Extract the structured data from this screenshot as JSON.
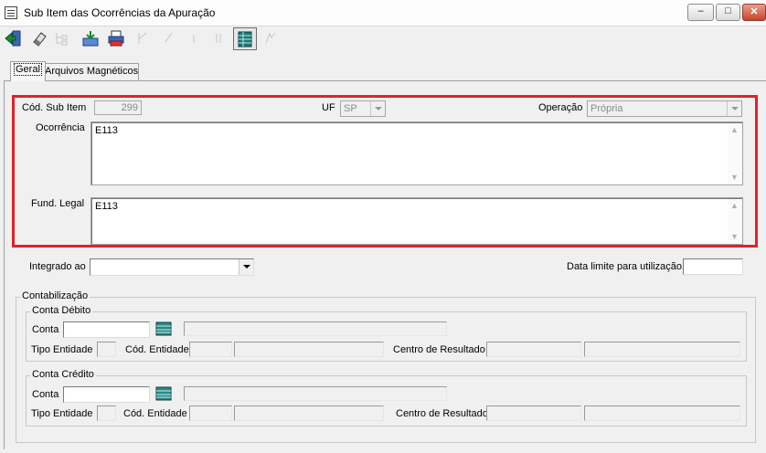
{
  "window": {
    "title": "Sub Item das Ocorrências da Apuração",
    "minimize_glyph": "–",
    "maximize_glyph": "□",
    "close_glyph": "✕"
  },
  "toolbar": {
    "buttons": [
      {
        "name": "exit-icon",
        "enabled": true
      },
      {
        "name": "eraser-icon",
        "enabled": true
      },
      {
        "name": "tree-icon",
        "enabled": false
      },
      {
        "name": "save-icon",
        "enabled": true
      },
      {
        "name": "print-icon",
        "enabled": true
      },
      {
        "name": "first-icon",
        "enabled": false
      },
      {
        "name": "prev-icon",
        "enabled": false
      },
      {
        "name": "next-icon",
        "enabled": false
      },
      {
        "name": "last-icon",
        "enabled": false
      },
      {
        "name": "grid-icon",
        "enabled": true
      },
      {
        "name": "refresh-icon",
        "enabled": false
      }
    ]
  },
  "tabs": [
    "Geral",
    "Arquivos Magnéticos"
  ],
  "form": {
    "cod_sub_item_label": "Cód. Sub Item",
    "cod_sub_item_value": "299",
    "uf_label": "UF",
    "uf_value": "SP",
    "operacao_label": "Operação",
    "operacao_value": "Própria",
    "ocorrencia_label": "Ocorrência",
    "ocorrencia_value": "E113",
    "fund_legal_label": "Fund. Legal",
    "fund_legal_value": "E113",
    "integrado_label": "Integrado ao",
    "integrado_value": "",
    "data_limite_label": "Data limite para utilização:",
    "data_limite_value": ""
  },
  "contabilizacao": {
    "legend": "Contabilização",
    "debito": {
      "legend": "Conta Débito",
      "conta_label": "Conta",
      "tipo_entidade_label": "Tipo Entidade",
      "cod_entidade_label": "Cód. Entidade",
      "centro_resultado_label": "Centro de Resultado"
    },
    "credito": {
      "legend": "Conta Crédito",
      "conta_label": "Conta",
      "tipo_entidade_label": "Tipo Entidade",
      "cod_entidade_label": "Cód. Entidade",
      "centro_resultado_label": "Centro de Resultado"
    }
  },
  "colors": {
    "highlight": "#e3202a",
    "background": "#f0f0f0"
  }
}
